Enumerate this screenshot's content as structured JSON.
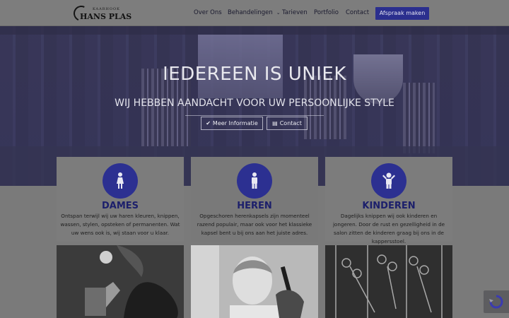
{
  "header": {
    "logo_top": "KAARHOOK",
    "logo_main": "HANS PLAS",
    "nav": [
      {
        "label": "Over Ons"
      },
      {
        "label": "Behandelingen"
      },
      {
        "label": "Tarieven"
      },
      {
        "label": "Portfolio"
      },
      {
        "label": "Contact"
      }
    ],
    "cta_label": "Afspraak maken"
  },
  "hero": {
    "title": "IEDEREEN IS UNIEK",
    "subtitle": "WIJ HEBBEN AANDACHT VOOR UW PERSOONLIJKE STYLE",
    "button_more": "Meer Informatie",
    "button_contact": "Contact"
  },
  "cards": [
    {
      "title": "DAMES",
      "text": "Ontspan terwijl wij uw haren kleuren, knippen, wassen, stylen, opsteken of permanenten. Wat uw wens ook is, wij staan voor u klaar.",
      "icon": "female-icon"
    },
    {
      "title": "HEREN",
      "text": "Opgeschoren herenkapsels zijn momenteel razend populair, maar ook voor het klassieke kapsel bent u bij ons aan het juiste adres.",
      "icon": "male-icon"
    },
    {
      "title": "KINDEREN",
      "text": "Dagelijks knippen wij ook kinderen en jongeren. Door de rust en gezelligheid in de salon zitten de kinderen graag bij ons in de kappersstoel.",
      "icon": "child-icon"
    }
  ],
  "colors": {
    "accent": "#2b2f8e",
    "title": "#1c1f6b"
  }
}
